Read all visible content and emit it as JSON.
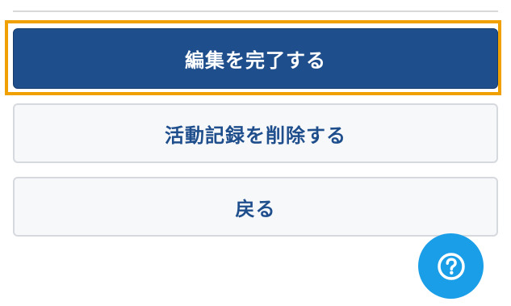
{
  "actions": {
    "complete_edit_label": "編集を完了する",
    "delete_record_label": "活動記録を削除する",
    "back_label": "戻る"
  },
  "help": {
    "icon": "question-circle-icon"
  },
  "colors": {
    "primary": "#1f4e8c",
    "highlight": "#f0a000",
    "fab": "#1b9ee8"
  }
}
